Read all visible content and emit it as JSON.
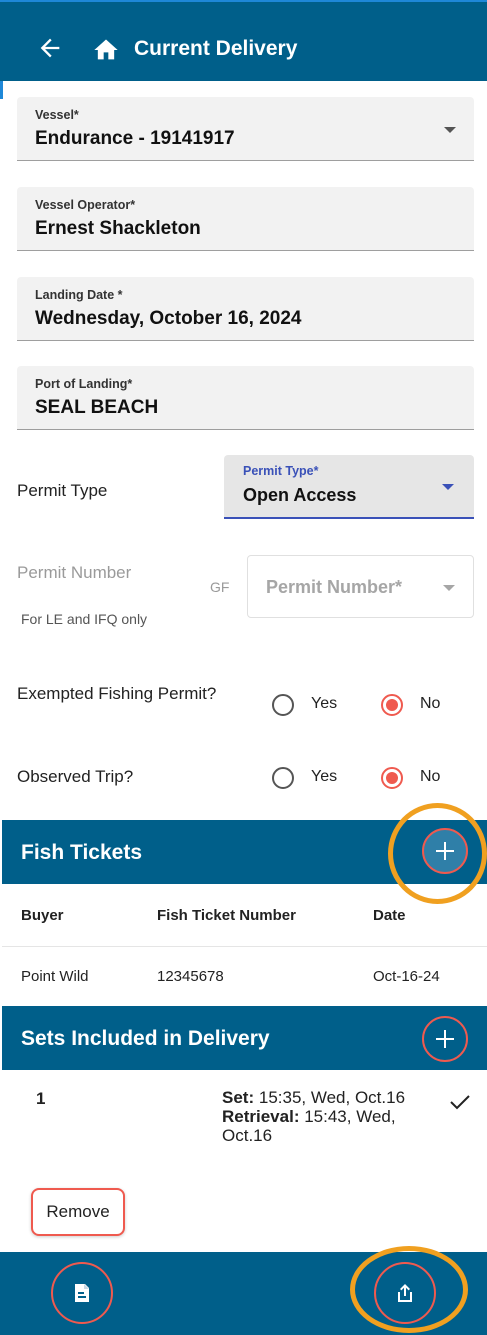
{
  "header": {
    "title": "Current Delivery",
    "back_icon": "arrow-left-icon",
    "home_icon": "home-icon"
  },
  "form": {
    "vessel": {
      "label": "Vessel*",
      "value": "Endurance - 19141917"
    },
    "vessel_operator": {
      "label": "Vessel Operator*",
      "value": "Ernest Shackleton"
    },
    "landing_date": {
      "label": "Landing Date *",
      "value": "Wednesday, October 16, 2024"
    },
    "port_of_landing": {
      "label": "Port of Landing*",
      "value": "SEAL BEACH"
    },
    "permit_type": {
      "row_label": "Permit Type",
      "label": "Permit Type*",
      "value": "Open Access"
    },
    "permit_number": {
      "row_label": "Permit Number",
      "hint": "For LE and IFQ only",
      "prefix": "GF",
      "placeholder": "Permit Number*"
    },
    "exempted_fishing": {
      "label": "Exempted Fishing Permit?",
      "options": [
        "Yes",
        "No"
      ],
      "selected": "No"
    },
    "observed_trip": {
      "label": "Observed Trip?",
      "options": [
        "Yes",
        "No"
      ],
      "selected": "No"
    }
  },
  "fish_tickets": {
    "title": "Fish Tickets",
    "columns": [
      "Buyer",
      "Fish Ticket Number",
      "Date"
    ],
    "rows": [
      {
        "buyer": "Point Wild",
        "number": "12345678",
        "date": "Oct-16-24"
      }
    ]
  },
  "sets": {
    "title": "Sets Included in Delivery",
    "items": [
      {
        "number": "1",
        "set_label": "Set:",
        "set_value": "15:35, Wed, Oct.16",
        "retrieval_label": "Retrieval:",
        "retrieval_value": "15:43, Wed, Oct.16"
      }
    ],
    "remove_label": "Remove"
  },
  "bottom_bar": {
    "left_icon": "document-icon",
    "right_icon": "share-upload-icon"
  },
  "colors": {
    "primary": "#005f8a",
    "accent": "#ef5a4f",
    "highlight_ring": "#f0a020",
    "select_focus": "#3a51b8"
  }
}
